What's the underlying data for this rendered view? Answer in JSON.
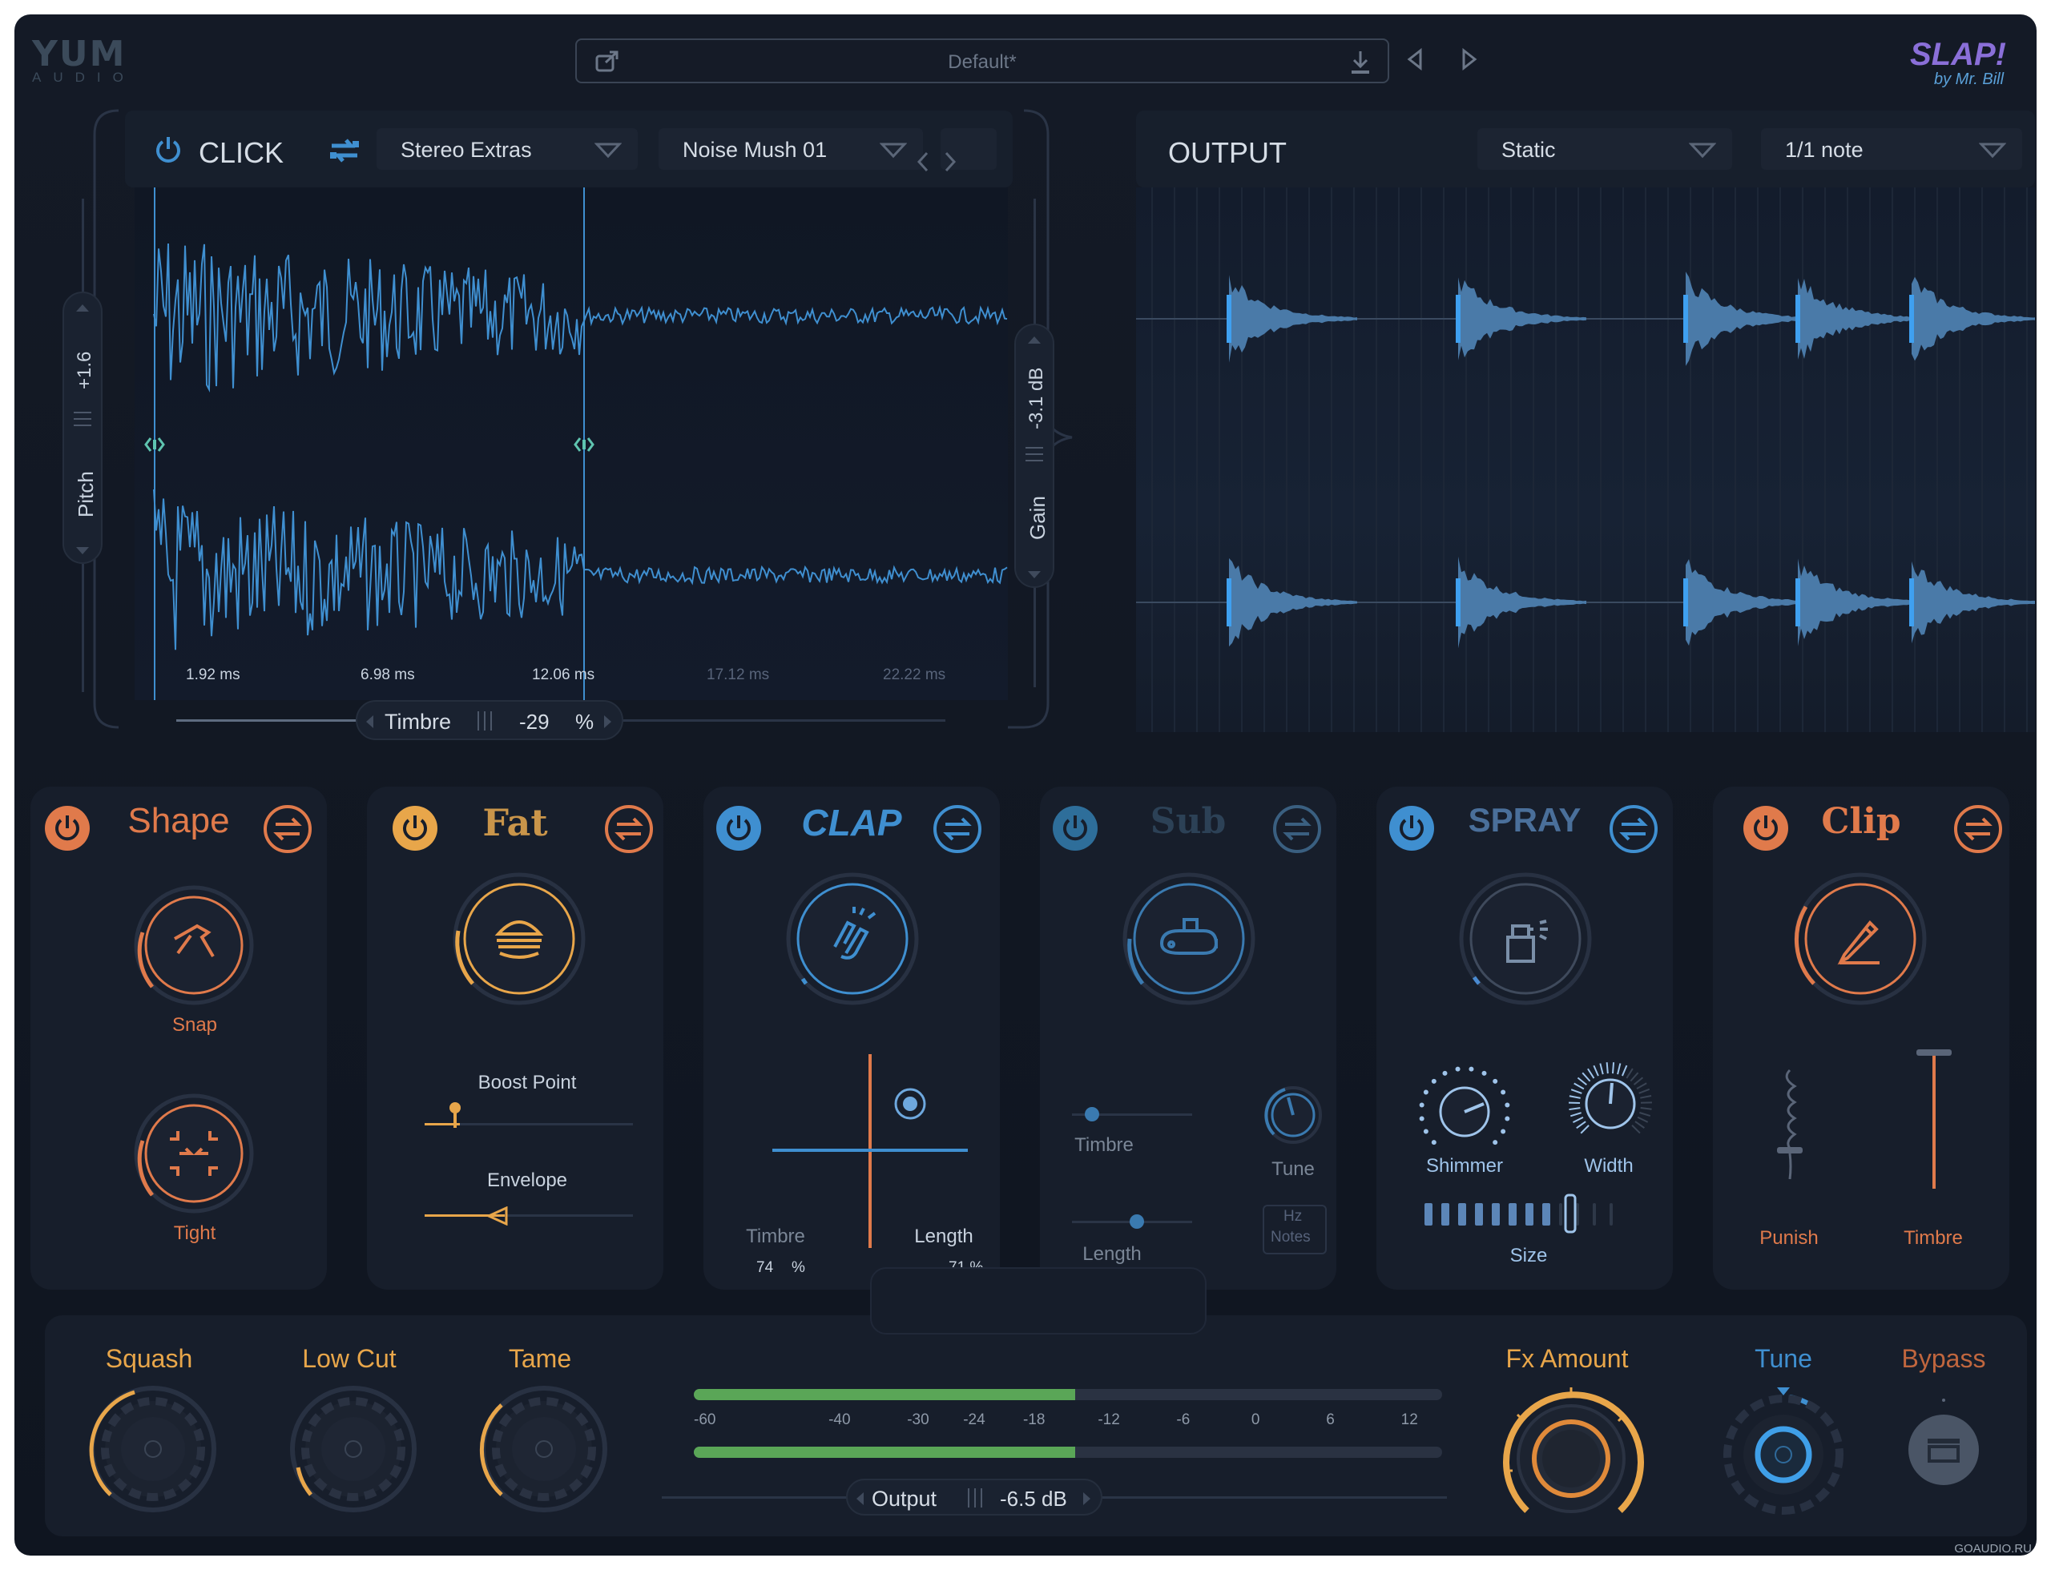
{
  "header": {
    "logo_text": "YUM",
    "logo_sub": "AUDIO",
    "preset_name": "Default*",
    "brand_text": "SLAP!",
    "brand_sub": "by Mr. Bill"
  },
  "click": {
    "title": "CLICK",
    "category": "Stereo Extras",
    "sample": "Noise Mush 01",
    "pitch_label": "Pitch",
    "pitch_value": "+1.6",
    "gain_label": "Gain",
    "gain_value": "-3.1 dB",
    "time_ticks": [
      "1.92 ms",
      "6.98 ms",
      "12.06 ms",
      "17.12 ms",
      "22.22 ms"
    ],
    "timbre_label": "Timbre",
    "timbre_value": "-29",
    "timbre_unit": "%"
  },
  "output_panel": {
    "title": "OUTPUT",
    "mode": "Static",
    "rate": "1/1 note"
  },
  "modules": [
    {
      "title": "Shape",
      "color": "#e07a4b",
      "labels": [
        "Snap",
        "Tight"
      ]
    },
    {
      "title": "Fat",
      "color": "#e8a64a",
      "labels": [
        "Boost Point",
        "Envelope"
      ]
    },
    {
      "title": "CLAP",
      "color": "#3f8fd0",
      "labels": [
        "Timbre",
        "Length"
      ],
      "values": [
        "74",
        "%",
        "71 %"
      ]
    },
    {
      "title": "Sub",
      "color": "#3a5f80",
      "labels": [
        "Timbre",
        "Tune",
        "Length"
      ],
      "toggle": [
        "Hz",
        "Notes"
      ]
    },
    {
      "title": "SPRAY",
      "color": "#4a8ad0",
      "labels": [
        "Shimmer",
        "Width",
        "Size"
      ]
    },
    {
      "title": "Clip",
      "color": "#e07a4b",
      "labels": [
        "Punish",
        "Timbre"
      ]
    }
  ],
  "bottom": {
    "squash": "Squash",
    "lowcut": "Low Cut",
    "tame": "Tame",
    "meter_ticks": [
      "-60",
      "-40",
      "-30",
      "-24",
      "-18",
      "-12",
      "-6",
      "0",
      "6",
      "12"
    ],
    "meter_level_l": 0.51,
    "meter_level_r": 0.51,
    "output_label": "Output",
    "output_value": "-6.5 dB",
    "fx_amount": "Fx Amount",
    "tune": "Tune",
    "bypass": "Bypass"
  },
  "watermark": "GOAUDIO.RU"
}
